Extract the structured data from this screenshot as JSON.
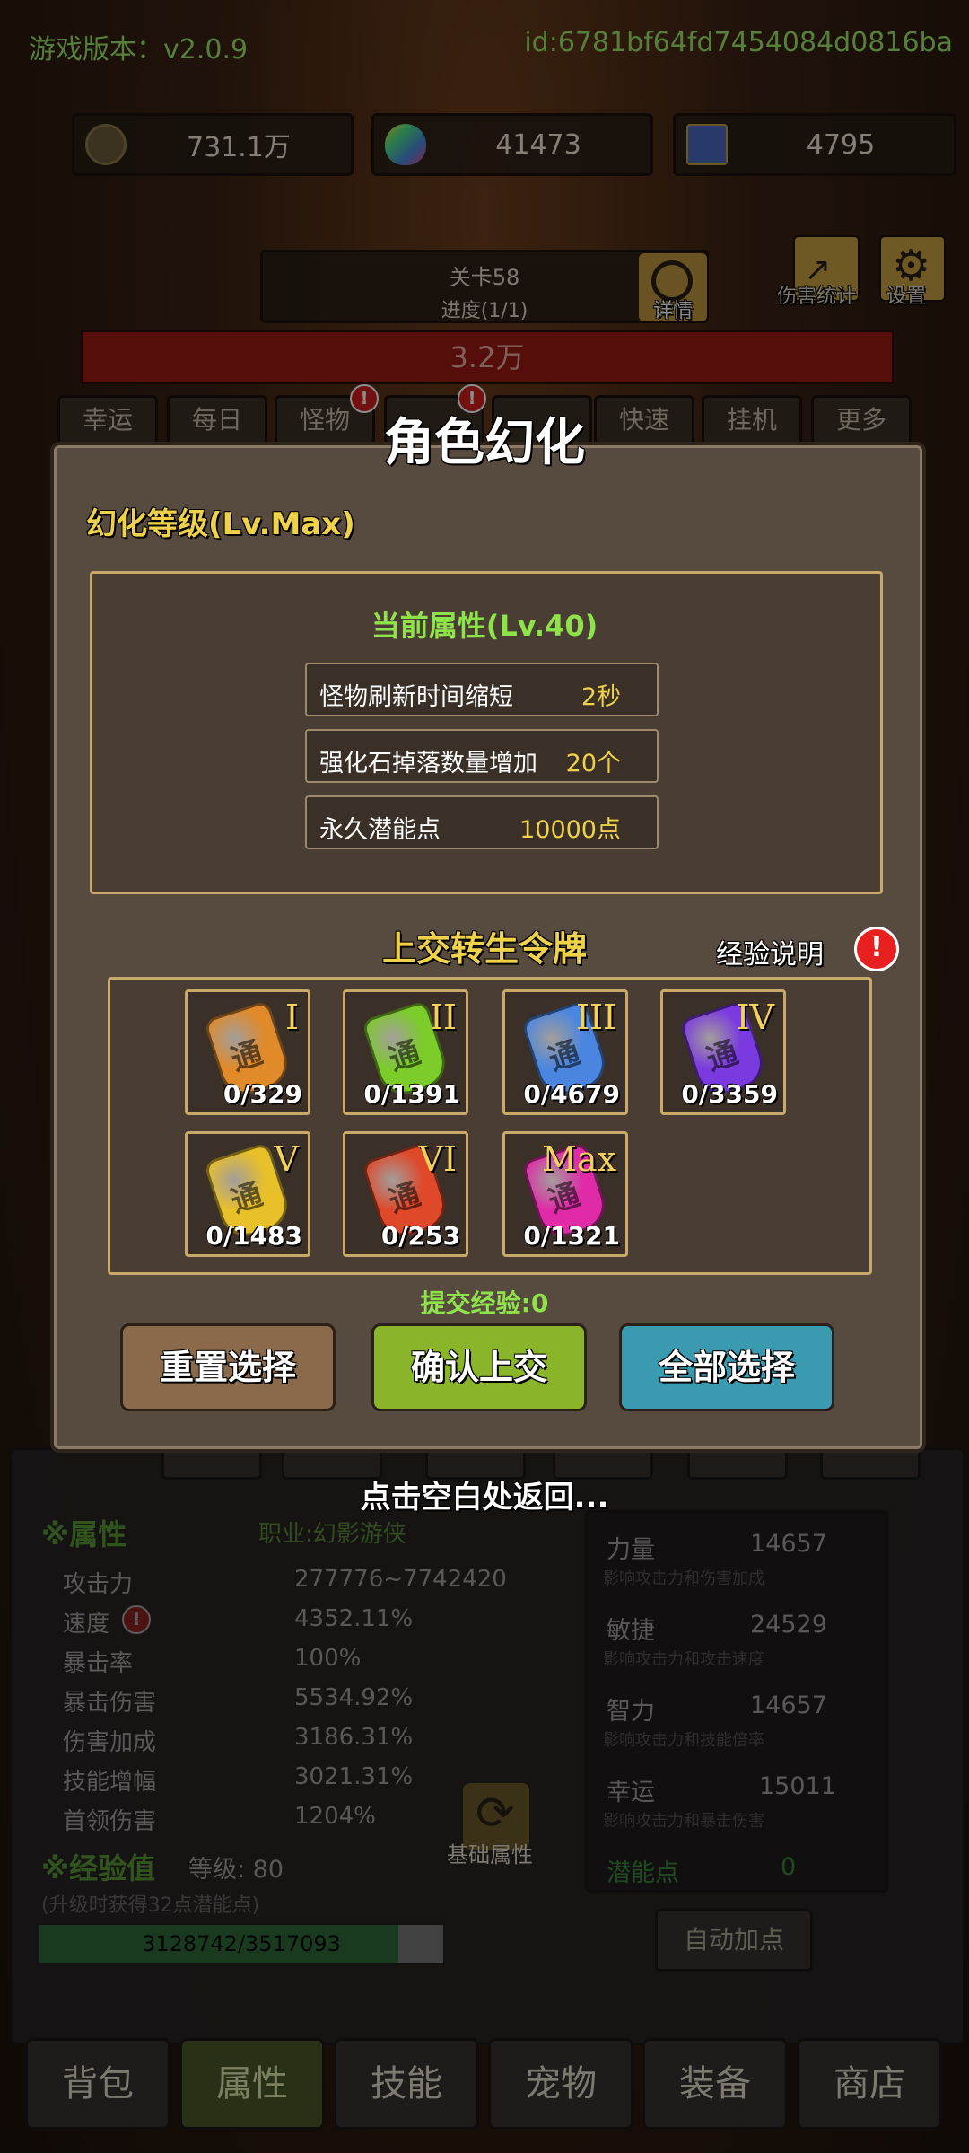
{
  "header": {
    "version": "游戏版本：v2.0.9",
    "user_id": "id:6781bf64fd7454084d0816ba"
  },
  "resources": [
    {
      "icon": "gold-coin-icon",
      "value": "731.1万"
    },
    {
      "icon": "rainbow-egg-icon",
      "value": "41473"
    },
    {
      "icon": "card-icon",
      "value": "4795"
    }
  ],
  "stage": {
    "title": "关卡58",
    "progress": "进度(1/1)",
    "detail_label": "详情"
  },
  "top_icons": {
    "damage_stats": "伤害统计",
    "settings": "设置"
  },
  "boss_hp": "3.2万",
  "tabs": [
    "幸运",
    "每日",
    "怪物",
    "",
    "",
    "快速",
    "挂机",
    "更多"
  ],
  "modal": {
    "title": "角色幻化",
    "level": "幻化等级(Lv.Max)",
    "current_attr_title": "当前属性(Lv.40)",
    "attributes": [
      {
        "name": "怪物刷新时间缩短",
        "value": "2秒"
      },
      {
        "name": "强化石掉落数量增加",
        "value": "20个"
      },
      {
        "name": "永久潜能点",
        "value": "10000点"
      }
    ],
    "token_title": "上交转生令牌",
    "exp_info": "经验说明",
    "tokens": [
      {
        "tier": "I",
        "count": "0/329",
        "color": "#e08a2a"
      },
      {
        "tier": "II",
        "count": "0/1391",
        "color": "#7ccc2a"
      },
      {
        "tier": "III",
        "count": "0/4679",
        "color": "#4a86e0"
      },
      {
        "tier": "IV",
        "count": "0/3359",
        "color": "#7a3ae0"
      },
      {
        "tier": "V",
        "count": "0/1483",
        "color": "#e8c02a"
      },
      {
        "tier": "VI",
        "count": "0/253",
        "color": "#e0482a"
      },
      {
        "tier": "Max",
        "count": "0/1321",
        "color": "#e02aa8"
      }
    ],
    "submit_exp": "提交经验:0",
    "buttons": {
      "reset": "重置选择",
      "confirm": "确认上交",
      "select_all": "全部选择"
    },
    "hint": "点击空白处返回..."
  },
  "char_panel": {
    "attr_title": "※属性",
    "job": "职业:幻影游侠",
    "stats": [
      {
        "k": "攻击力",
        "v": "277776~7742420"
      },
      {
        "k": "速度",
        "v": "4352.11%"
      },
      {
        "k": "暴击率",
        "v": "100%"
      },
      {
        "k": "暴击伤害",
        "v": "5534.92%"
      },
      {
        "k": "伤害加成",
        "v": "3186.31%"
      },
      {
        "k": "技能增幅",
        "v": "3021.31%"
      },
      {
        "k": "首领伤害",
        "v": "1204%"
      }
    ],
    "exp_title": "※经验值",
    "exp_level": "等级: 80",
    "exp_note": "(升级时获得32点潜能点)",
    "exp_progress": "3128742/3517093",
    "exp_ratio": 0.889,
    "base_attr_label": "基础属性",
    "right_stats": [
      {
        "k": "力量",
        "v": "14657",
        "d": "影响攻击力和伤害加成"
      },
      {
        "k": "敏捷",
        "v": "24529",
        "d": "影响攻击力和攻击速度"
      },
      {
        "k": "智力",
        "v": "14657",
        "d": "影响攻击力和技能倍率"
      },
      {
        "k": "幸运",
        "v": "15011",
        "d": "影响攻击力和暴击伤害"
      }
    ],
    "potential": {
      "k": "潜能点",
      "v": "0"
    },
    "auto_add": "自动加点"
  },
  "nav": [
    "背包",
    "属性",
    "技能",
    "宠物",
    "装备",
    "商店"
  ]
}
